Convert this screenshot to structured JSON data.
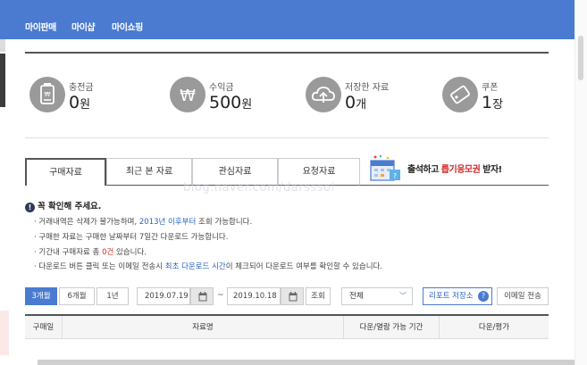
{
  "nav": {
    "items": [
      {
        "label": "마이판매"
      },
      {
        "label": "마이샵"
      },
      {
        "label": "마이쇼핑"
      }
    ]
  },
  "stats": [
    {
      "label": "충전금",
      "value": "0",
      "unit": "원",
      "icon": "wallet-icon"
    },
    {
      "label": "수익금",
      "value": "500",
      "unit": "원",
      "icon": "won-icon"
    },
    {
      "label": "저장한 자료",
      "value": "0",
      "unit": "개",
      "icon": "cloud-upload-icon"
    },
    {
      "label": "쿠폰",
      "value": "1",
      "unit": "장",
      "icon": "coupon-icon"
    }
  ],
  "tabs": [
    {
      "label": "구매자료",
      "active": true
    },
    {
      "label": "최근 본 자료",
      "active": false
    },
    {
      "label": "관심자료",
      "active": false
    },
    {
      "label": "요청자료",
      "active": false
    }
  ],
  "banner": {
    "prefix": "출석하고 ",
    "highlight": "릅기응모권",
    "suffix": " 받자!",
    "highlight_color": "#d12929"
  },
  "watermark": "blog.naver.com/darsssol",
  "notice": {
    "title": "꼭 확인해 주세요.",
    "lines": [
      {
        "a": "거래내역은 삭제가 불가능하며, ",
        "b": "2013년 이후부터",
        "c": " 조회 가능합니다."
      },
      {
        "a": "구매한 자료는 구매한 날짜부터 7일간 다운로드 가능합니다."
      },
      {
        "a": "기간내 구매자료 총 ",
        "b": "0건",
        "c": " 있습니다."
      },
      {
        "a": "다운로드 버튼 클릭 또는 이메일 전송시 ",
        "b": "최초 다운로드 시간",
        "c": "이 체크되어 다운로드 여부를 확인할 수 있습니다."
      }
    ]
  },
  "filters": {
    "periods": [
      {
        "label": "3개월",
        "active": true
      },
      {
        "label": "6개월",
        "active": false
      },
      {
        "label": "1년",
        "active": false
      }
    ],
    "start_date": "2019.07.19",
    "end_date": "2019.10.18",
    "tilde": "~",
    "search_label": "조회",
    "select_value": "전체",
    "report_label": "리포트 저장소",
    "email_label": "이메일 전송"
  },
  "table": {
    "columns": [
      "구매일",
      "자료명",
      "다운/열람 가능 기간",
      "다운/평가"
    ]
  },
  "colors": {
    "accent": "#4a7bd0",
    "link": "#2962c4",
    "alert": "#d12929"
  }
}
